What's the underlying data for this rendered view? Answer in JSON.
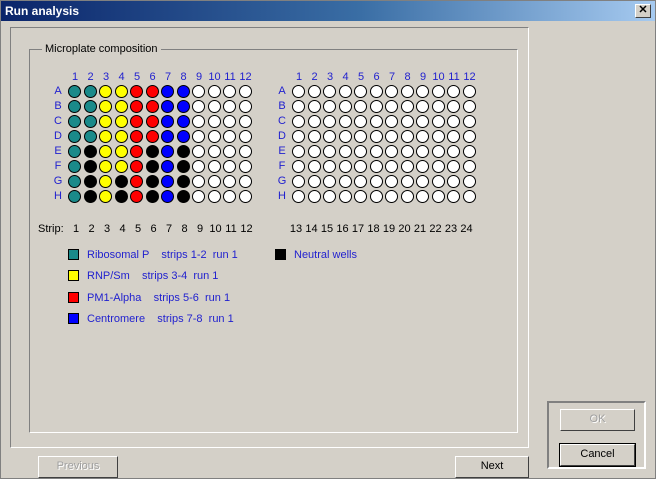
{
  "window": {
    "title": "Run analysis",
    "close_label": "✕"
  },
  "group": {
    "label": "Microplate composition"
  },
  "plate1": {
    "columns": [
      "1",
      "2",
      "3",
      "4",
      "5",
      "6",
      "7",
      "8",
      "9",
      "10",
      "11",
      "12"
    ],
    "rows": [
      "A",
      "B",
      "C",
      "D",
      "E",
      "F",
      "G",
      "H"
    ],
    "wells": [
      [
        "teal",
        "teal",
        "yellow",
        "yellow",
        "red",
        "red",
        "blue",
        "blue",
        "empty",
        "empty",
        "empty",
        "empty"
      ],
      [
        "teal",
        "teal",
        "yellow",
        "yellow",
        "red",
        "red",
        "blue",
        "blue",
        "empty",
        "empty",
        "empty",
        "empty"
      ],
      [
        "teal",
        "teal",
        "yellow",
        "yellow",
        "red",
        "red",
        "blue",
        "blue",
        "empty",
        "empty",
        "empty",
        "empty"
      ],
      [
        "teal",
        "teal",
        "yellow",
        "yellow",
        "red",
        "red",
        "blue",
        "blue",
        "empty",
        "empty",
        "empty",
        "empty"
      ],
      [
        "teal",
        "black",
        "yellow",
        "yellow",
        "red",
        "black",
        "blue",
        "black",
        "empty",
        "empty",
        "empty",
        "empty"
      ],
      [
        "teal",
        "black",
        "yellow",
        "yellow",
        "red",
        "black",
        "blue",
        "black",
        "empty",
        "empty",
        "empty",
        "empty"
      ],
      [
        "teal",
        "black",
        "yellow",
        "black",
        "red",
        "black",
        "blue",
        "black",
        "empty",
        "empty",
        "empty",
        "empty"
      ],
      [
        "teal",
        "black",
        "yellow",
        "black",
        "red",
        "black",
        "blue",
        "black",
        "empty",
        "empty",
        "empty",
        "empty"
      ]
    ]
  },
  "plate2": {
    "columns": [
      "1",
      "2",
      "3",
      "4",
      "5",
      "6",
      "7",
      "8",
      "9",
      "10",
      "11",
      "12"
    ],
    "rows": [
      "A",
      "B",
      "C",
      "D",
      "E",
      "F",
      "G",
      "H"
    ]
  },
  "strips": {
    "label": "Strip:",
    "plate1": [
      "1",
      "2",
      "3",
      "4",
      "5",
      "6",
      "7",
      "8",
      "9",
      "10",
      "11",
      "12"
    ],
    "plate2": [
      "13",
      "14",
      "15",
      "16",
      "17",
      "18",
      "19",
      "20",
      "21",
      "22",
      "23",
      "24"
    ]
  },
  "legend": [
    {
      "color": "#1a8a8a",
      "text": "Ribosomal P    strips 1-2  run 1"
    },
    {
      "color": "#ffff00",
      "text": "RNP/Sm    strips 3-4  run 1"
    },
    {
      "color": "#ff0000",
      "text": "PM1-Alpha    strips 5-6  run 1"
    },
    {
      "color": "#0000ff",
      "text": "Centromere    strips 7-8  run 1"
    },
    {
      "color": "#000000",
      "text": "Neutral wells"
    }
  ],
  "well_colors": {
    "teal": "#1a8a8a",
    "yellow": "#ffff00",
    "red": "#ff0000",
    "blue": "#0000ff",
    "black": "#000000",
    "empty": "#ffffff"
  },
  "buttons": {
    "ok": "OK",
    "cancel": "Cancel",
    "previous": "Previous",
    "next": "Next"
  }
}
